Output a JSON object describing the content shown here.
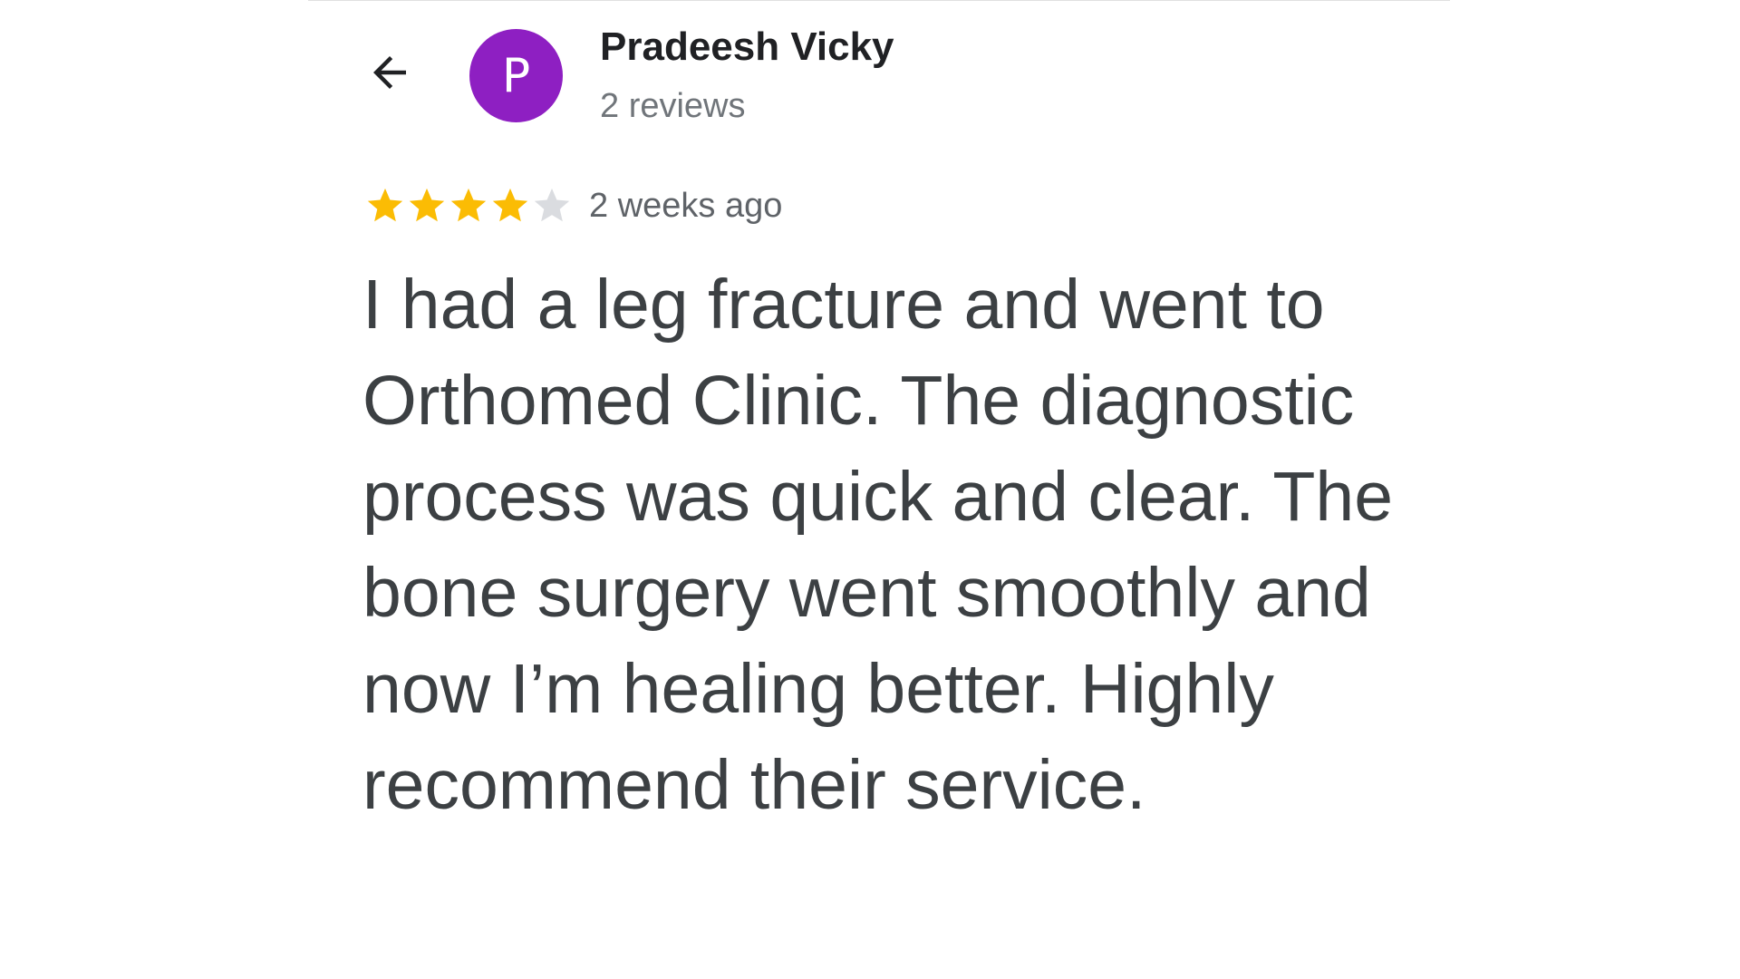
{
  "reviewer": {
    "name": "Pradeesh Vicky",
    "review_count": "2 reviews",
    "avatar_initial": "P",
    "avatar_color": "#8e1fc2"
  },
  "review": {
    "rating": 4,
    "max_rating": 5,
    "time": "2 weeks ago",
    "text": "I had a leg fracture and went to Orthomed Clinic. The diagnostic process was quick and clear. The bone surgery went smoothly and now I’m healing better. Highly recommend their service."
  },
  "colors": {
    "star_filled": "#fbbc04",
    "star_empty": "#dadce0"
  },
  "icons": {
    "back": "arrow-left-icon",
    "star": "star-icon"
  }
}
